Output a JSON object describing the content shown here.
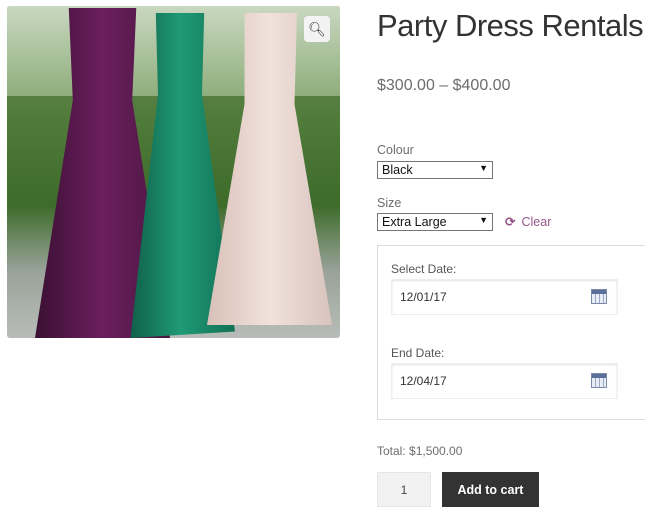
{
  "product": {
    "title": "Party Dress Rentals",
    "price_range": "$300.00 – $400.00",
    "zoom_icon": "magnifier-icon"
  },
  "variations": {
    "colour_label": "Colour",
    "colour_value": "Black",
    "size_label": "Size",
    "size_value": "Extra Large",
    "clear_label": "Clear",
    "clear_icon": "refresh-icon"
  },
  "booking": {
    "start_label": "Select Date:",
    "start_value": "12/01/17",
    "end_label": "End Date:",
    "end_value": "12/04/17"
  },
  "cart": {
    "total": "Total: $1,500.00",
    "quantity": "1",
    "add_label": "Add to cart"
  },
  "colors": {
    "accent": "#96588a",
    "button": "#333333"
  }
}
